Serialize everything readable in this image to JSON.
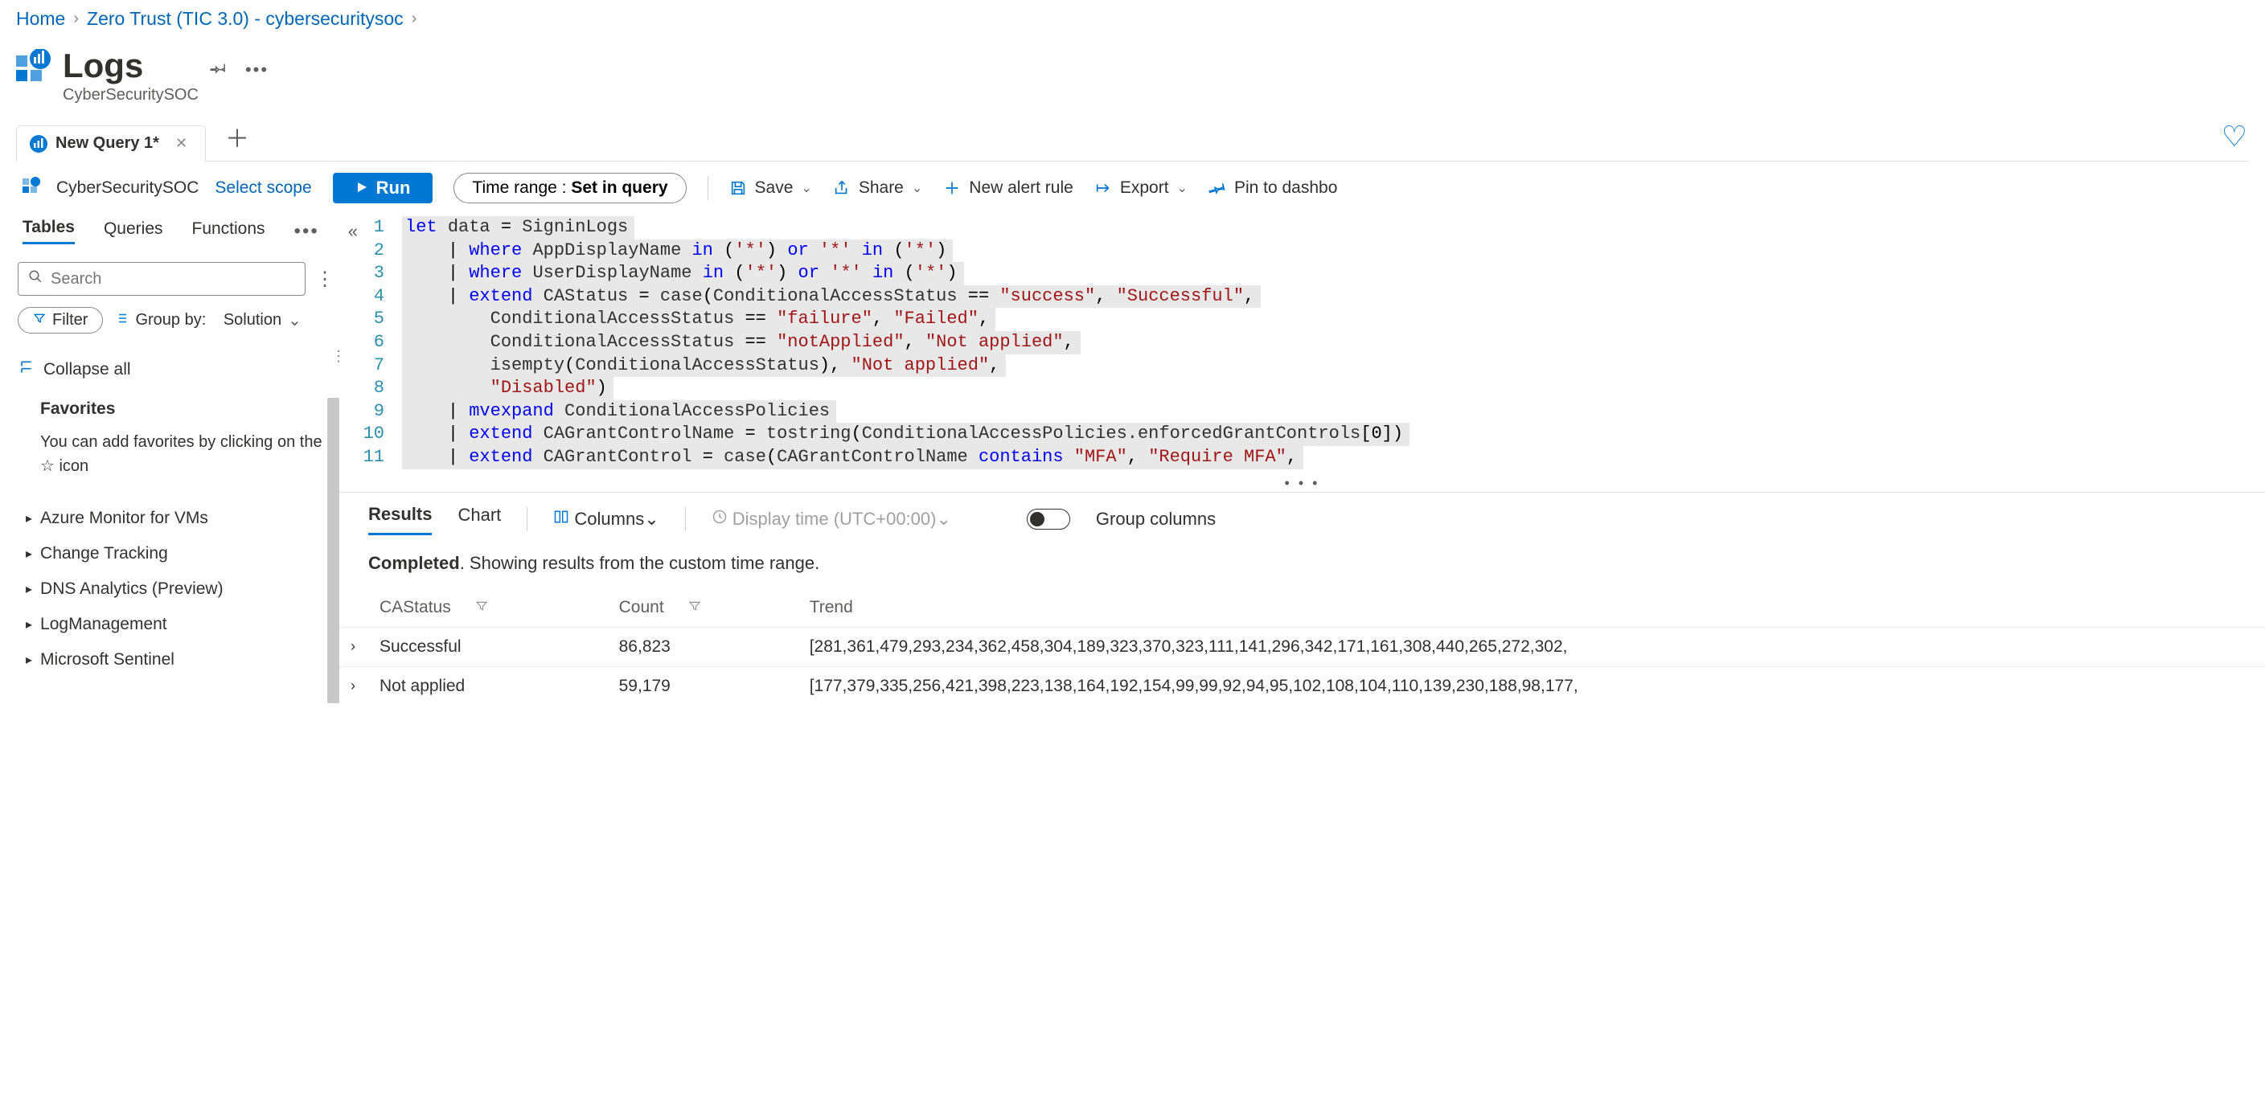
{
  "breadcrumb": {
    "home": "Home",
    "dash": "Zero Trust (TIC 3.0) - cybersecuritysoc"
  },
  "page": {
    "title": "Logs",
    "subtitle": "CyberSecuritySOC"
  },
  "query_tab": {
    "label": "New Query 1*"
  },
  "scope": {
    "name": "CyberSecuritySOC",
    "select": "Select scope"
  },
  "toolbar": {
    "run": "Run",
    "time_range_label": "Time range : ",
    "time_range_value": "Set in query",
    "save": "Save",
    "share": "Share",
    "new_alert": "New alert rule",
    "export": "Export",
    "pin": "Pin to dashbo"
  },
  "left_tabs": {
    "tables": "Tables",
    "queries": "Queries",
    "functions": "Functions"
  },
  "search": {
    "placeholder": "Search"
  },
  "filter": {
    "label": "Filter",
    "group_label": "Group by:",
    "group_value": "Solution"
  },
  "collapse_all": "Collapse all",
  "favorites": {
    "heading": "Favorites",
    "text": "You can add favorites by clicking on the ☆ icon"
  },
  "tree": [
    "Azure Monitor for VMs",
    "Change Tracking",
    "DNS Analytics (Preview)",
    "LogManagement",
    "Microsoft Sentinel"
  ],
  "code": {
    "1": "let data = SigninLogs",
    "2": "    | where AppDisplayName in ('*') or '*' in ('*')",
    "3": "    | where UserDisplayName in ('*') or '*' in ('*')",
    "4": "    | extend CAStatus = case(ConditionalAccessStatus == \"success\", \"Successful\",",
    "5": "        ConditionalAccessStatus == \"failure\", \"Failed\",",
    "6": "        ConditionalAccessStatus == \"notApplied\", \"Not applied\",",
    "7": "        isempty(ConditionalAccessStatus), \"Not applied\",",
    "8": "        \"Disabled\")",
    "9": "    | mvexpand ConditionalAccessPolicies",
    "10": "    | extend CAGrantControlName = tostring(ConditionalAccessPolicies.enforcedGrantControls[0])",
    "11": "    | extend CAGrantControl = case(CAGrantControlName contains \"MFA\", \"Require MFA\","
  },
  "results_bar": {
    "results": "Results",
    "chart": "Chart",
    "columns": "Columns",
    "display_time": "Display time (UTC+00:00)",
    "group_cols": "Group columns"
  },
  "results_status": {
    "a": "Completed",
    "b": ". Showing results from the custom time range."
  },
  "table": {
    "cols": {
      "c1": "CAStatus",
      "c2": "Count",
      "c3": "Trend"
    },
    "rows": [
      {
        "status": "Successful",
        "count": "86,823",
        "trend": "[281,361,479,293,234,362,458,304,189,323,370,323,111,141,296,342,171,161,308,440,265,272,302,"
      },
      {
        "status": "Not applied",
        "count": "59,179",
        "trend": "[177,379,335,256,421,398,223,138,164,192,154,99,99,92,94,95,102,108,104,110,139,230,188,98,177,"
      }
    ]
  },
  "chart_data": {
    "type": "table",
    "title": "CAStatus counts with trend",
    "rows": [
      {
        "CAStatus": "Successful",
        "Count": 86823,
        "Trend": [
          281,
          361,
          479,
          293,
          234,
          362,
          458,
          304,
          189,
          323,
          370,
          323,
          111,
          141,
          296,
          342,
          171,
          161,
          308,
          440,
          265,
          272,
          302
        ]
      },
      {
        "CAStatus": "Not applied",
        "Count": 59179,
        "Trend": [
          177,
          379,
          335,
          256,
          421,
          398,
          223,
          138,
          164,
          192,
          154,
          99,
          99,
          92,
          94,
          95,
          102,
          108,
          104,
          110,
          139,
          230,
          188,
          98,
          177
        ]
      }
    ]
  }
}
